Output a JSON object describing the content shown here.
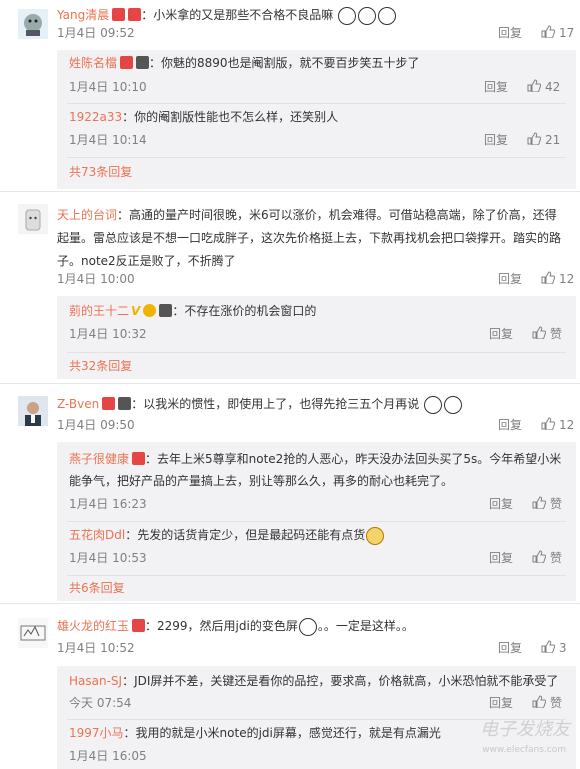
{
  "c1": {
    "user": "Yang清晨",
    "text": "：小米拿的又是那些不合格不良品嘛",
    "time": "1月4日 09:52",
    "reply": "回复",
    "likes": "17",
    "replies": [
      {
        "user": "姓陈名檔",
        "text": "：你魅的8890也是阉割版，就不要百步笑五十步了",
        "time": "1月4日 10:10",
        "reply": "回复",
        "likes": "42"
      },
      {
        "user": "1922a33",
        "text": "：你的阉割版性能也不怎么样，还笑别人",
        "time": "1月4日 10:14",
        "reply": "回复",
        "likes": "21"
      }
    ],
    "more": "共73条回复"
  },
  "c2": {
    "user": "天上的台词",
    "text": "：高通的量产时间很晚，米6可以涨价，机会难得。可借站稳高端，除了价高，还得起量。雷总应该是不想一口吃成胖子，这次先价格挺上去，下款再找机会把口袋撑开。踏实的路子。note2反正是败了，不折腾了",
    "time": "1月4日 10:00",
    "reply": "回复",
    "likes": "12",
    "replies": [
      {
        "user": "莂的王十二",
        "text": "：不存在涨价的机会窗口的",
        "time": "1月4日 10:32",
        "reply": "回复",
        "likes": "赞"
      }
    ],
    "more": "共32条回复"
  },
  "c3": {
    "user": "Z-Bven",
    "text": "：以我米的惯性，即使用上了，也得先抢三五个月再说",
    "time": "1月4日 09:50",
    "reply": "回复",
    "likes": "12",
    "replies": [
      {
        "user": "燕子很健康",
        "text": "：去年上米5尊享和note2抢的人恶心，昨天没办法回头买了5s。今年希望小米能争气，把好产品的产量搞上去，别让等那么久，再多的耐心也耗完了。",
        "time": "1月4日 16:23",
        "reply": "回复",
        "likes": "赞"
      },
      {
        "user": "五花肉Ddl",
        "text": "：先发的话货肯定少，但是最起码还能有点货",
        "time": "1月4日 10:53",
        "reply": "回复",
        "likes": "赞"
      }
    ],
    "more": "共6条回复"
  },
  "c4": {
    "user": "雄火龙的红玉",
    "text": "：2299，然后用jdi的变色屏",
    "text2": "。。一定是这样。。",
    "time": "1月4日 10:52",
    "reply": "回复",
    "likes": "3",
    "replies": [
      {
        "user": "Hasan-SJ",
        "text": "：JDI屏并不差，关键还是看你的品控，要求高，价格就高，小米恐怕就不能承受了",
        "time": "今天 07:54",
        "reply": "回复",
        "likes": "赞"
      },
      {
        "user": "1997小马",
        "text": "：我用的就是小米note的jdi屏幕，感觉还行，就是有点漏光",
        "time": "1月4日 16:05",
        "reply": "",
        "likes": ""
      }
    ]
  },
  "watermark": "电子发烧友",
  "watermark_sub": "www.elecfans.com",
  "colors": {
    "username": "#eb7350",
    "reply_bg": "#f2f2f5",
    "meta": "#808080"
  }
}
